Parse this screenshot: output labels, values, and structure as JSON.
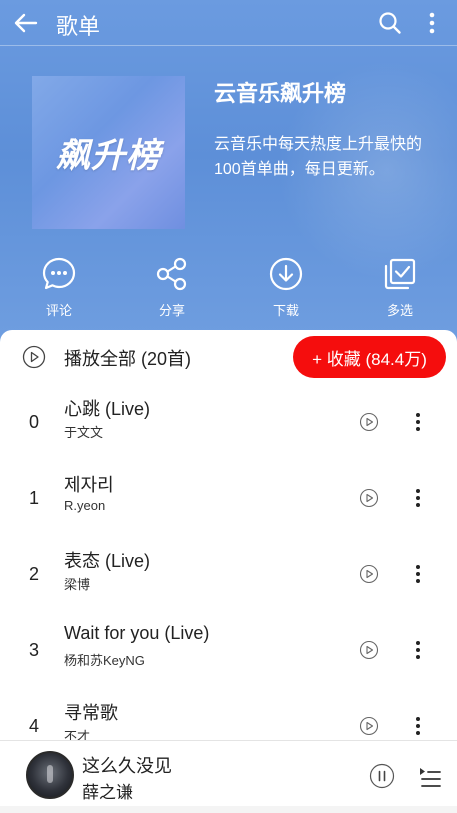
{
  "header": {
    "title": "歌单"
  },
  "playlist": {
    "cover_text": "飙升榜",
    "name": "云音乐飙升榜",
    "description": "云音乐中每天热度上升最快的100首单曲，每日更新。"
  },
  "actions": [
    {
      "label": "评论",
      "icon": "comment-icon"
    },
    {
      "label": "分享",
      "icon": "share-icon"
    },
    {
      "label": "下载",
      "icon": "download-icon"
    },
    {
      "label": "多选",
      "icon": "multi-select-icon"
    }
  ],
  "list_header": {
    "play_all_label": "播放全部 (20首)",
    "collect_label": "+ 收藏 (84.4万)"
  },
  "songs": [
    {
      "index": "0",
      "title": "心跳 (Live)",
      "artist": "于文文"
    },
    {
      "index": "1",
      "title": "제자리",
      "artist": "R.yeon"
    },
    {
      "index": "2",
      "title": "表态 (Live)",
      "artist": "梁博"
    },
    {
      "index": "3",
      "title": "Wait for you (Live)",
      "artist": "杨和苏KeyNG"
    },
    {
      "index": "4",
      "title": "寻常歌",
      "artist": "不才"
    }
  ],
  "now_playing": {
    "title": "这么久没见",
    "artist": "薛之谦"
  },
  "colors": {
    "hero": "#6b9be0",
    "accent": "#f50d0d",
    "text": "#222222"
  }
}
